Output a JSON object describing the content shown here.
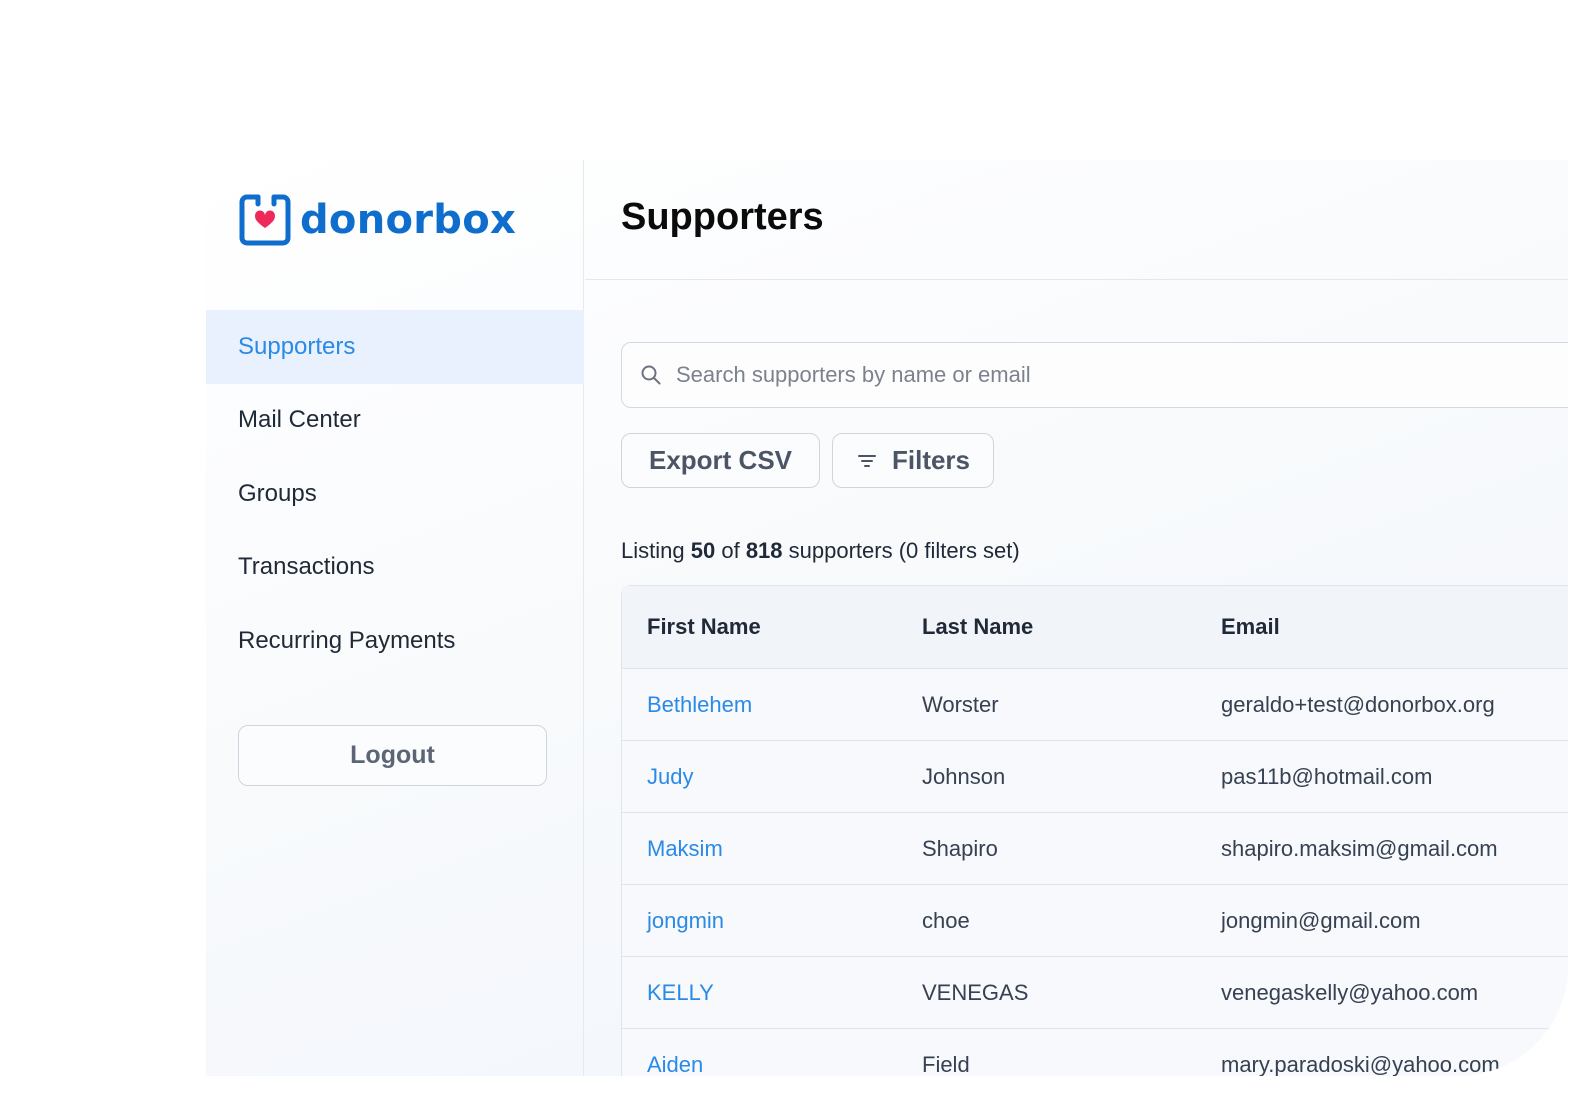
{
  "brand": {
    "name": "donorbox",
    "color": "#0f6ecd",
    "heart_color": "#ee2a5b"
  },
  "sidebar": {
    "items": [
      {
        "label": "Supporters",
        "active": true
      },
      {
        "label": "Mail Center",
        "active": false
      },
      {
        "label": "Groups",
        "active": false
      },
      {
        "label": "Transactions",
        "active": false
      },
      {
        "label": "Recurring Payments",
        "active": false
      }
    ],
    "logout_label": "Logout"
  },
  "header": {
    "title": "Supporters"
  },
  "search": {
    "placeholder": "Search supporters by name or email",
    "value": ""
  },
  "toolbar": {
    "export_label": "Export CSV",
    "filters_label": "Filters"
  },
  "listing": {
    "prefix": "Listing",
    "shown": "50",
    "of": "of",
    "total": "818",
    "suffix": "supporters (0 filters set)"
  },
  "table": {
    "columns": [
      "First Name",
      "Last Name",
      "Email"
    ],
    "rows": [
      {
        "first": "Bethlehem",
        "last": "Worster",
        "email": "geraldo+test@donorbox.org"
      },
      {
        "first": "Judy",
        "last": "Johnson",
        "email": "pas11b@hotmail.com"
      },
      {
        "first": "Maksim",
        "last": "Shapiro",
        "email": "shapiro.maksim@gmail.com"
      },
      {
        "first": "jongmin",
        "last": "choe",
        "email": "jongmin@gmail.com"
      },
      {
        "first": "KELLY",
        "last": "VENEGAS",
        "email": "venegaskelly@yahoo.com"
      },
      {
        "first": "Aiden",
        "last": "Field",
        "email": "mary.paradoski@yahoo.com"
      }
    ]
  }
}
